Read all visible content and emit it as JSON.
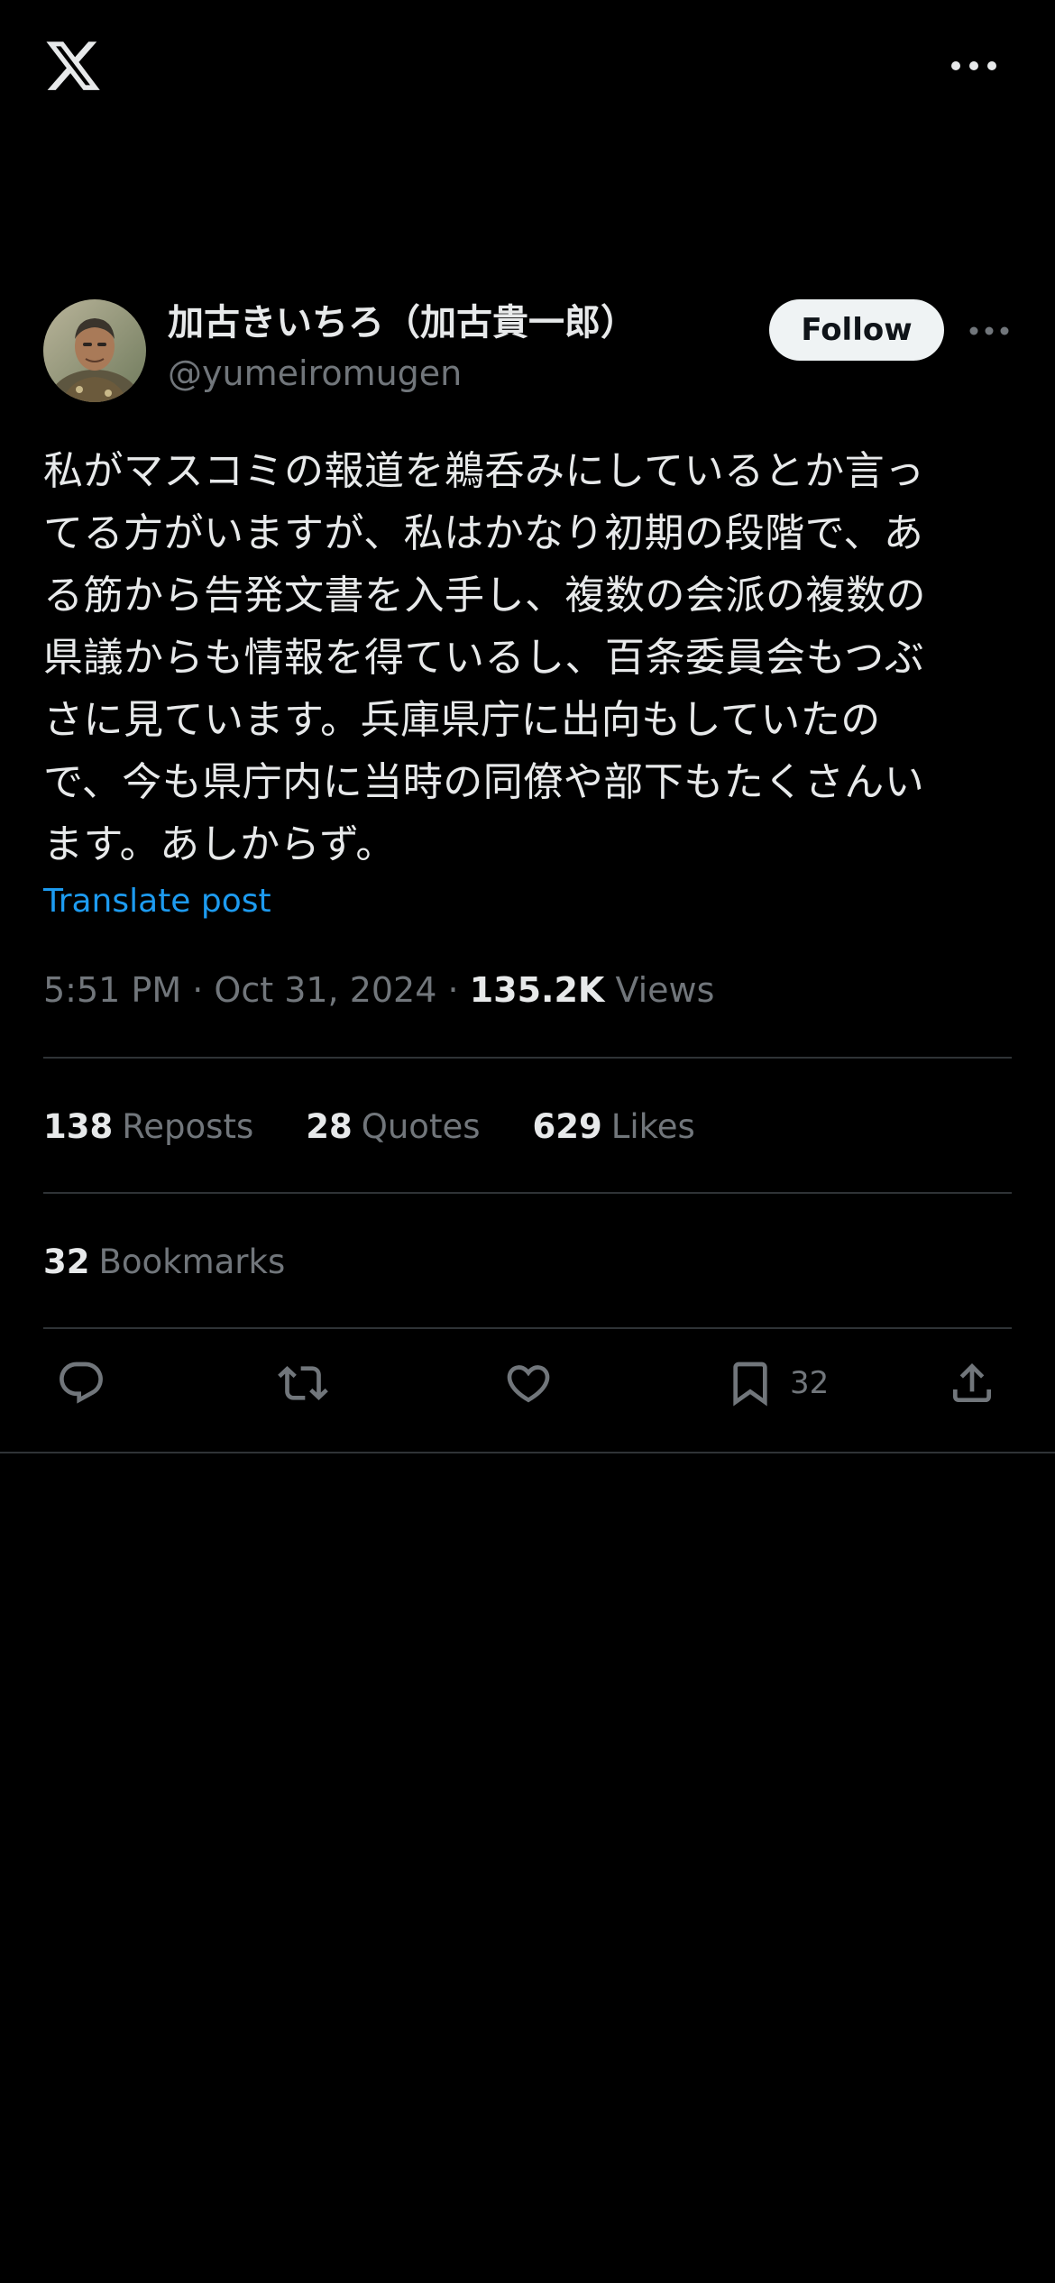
{
  "colors": {
    "background": "#000000",
    "text_primary": "#e7e9ea",
    "text_secondary": "#71767b",
    "link": "#1d9bf0",
    "follow_bg": "#eff3f4",
    "divider": "#2f3336"
  },
  "header": {
    "logo_icon": "x-logo-icon",
    "more_icon": "more-horizontal-icon"
  },
  "author": {
    "display_name": "加古きいちろ（加古貴一郎）",
    "handle": "@yumeiromugen",
    "follow_label": "Follow",
    "avatar_icon": "avatar-photo"
  },
  "tweet": {
    "text": "私がマスコミの報道を鵜呑みにしているとか言っ\nてる方がいますが、私はかなり初期の段階で、あ\nる筋から告発文書を入手し、複数の会派の複数の\n県議からも情報を得ているし、百条委員会もつぶ\nさに見ています。兵庫県庁に出向もしていたの\nで、今も県庁内に当時の同僚や部下もたくさんい\nます。あしからず。",
    "translate_label": "Translate post",
    "time": "5:51 PM",
    "date": "Oct 31, 2024",
    "sep": "·",
    "views_count": "135.2K",
    "views_label": "Views"
  },
  "stats": {
    "reposts_count": "138",
    "reposts_label": "Reposts",
    "quotes_count": "28",
    "quotes_label": "Quotes",
    "likes_count": "629",
    "likes_label": "Likes",
    "bookmarks_count": "32",
    "bookmarks_label": "Bookmarks"
  },
  "actions": {
    "reply_icon": "reply-icon",
    "repost_icon": "repost-icon",
    "like_icon": "heart-icon",
    "bookmark_icon": "bookmark-icon",
    "bookmark_count": "32",
    "share_icon": "share-icon"
  }
}
